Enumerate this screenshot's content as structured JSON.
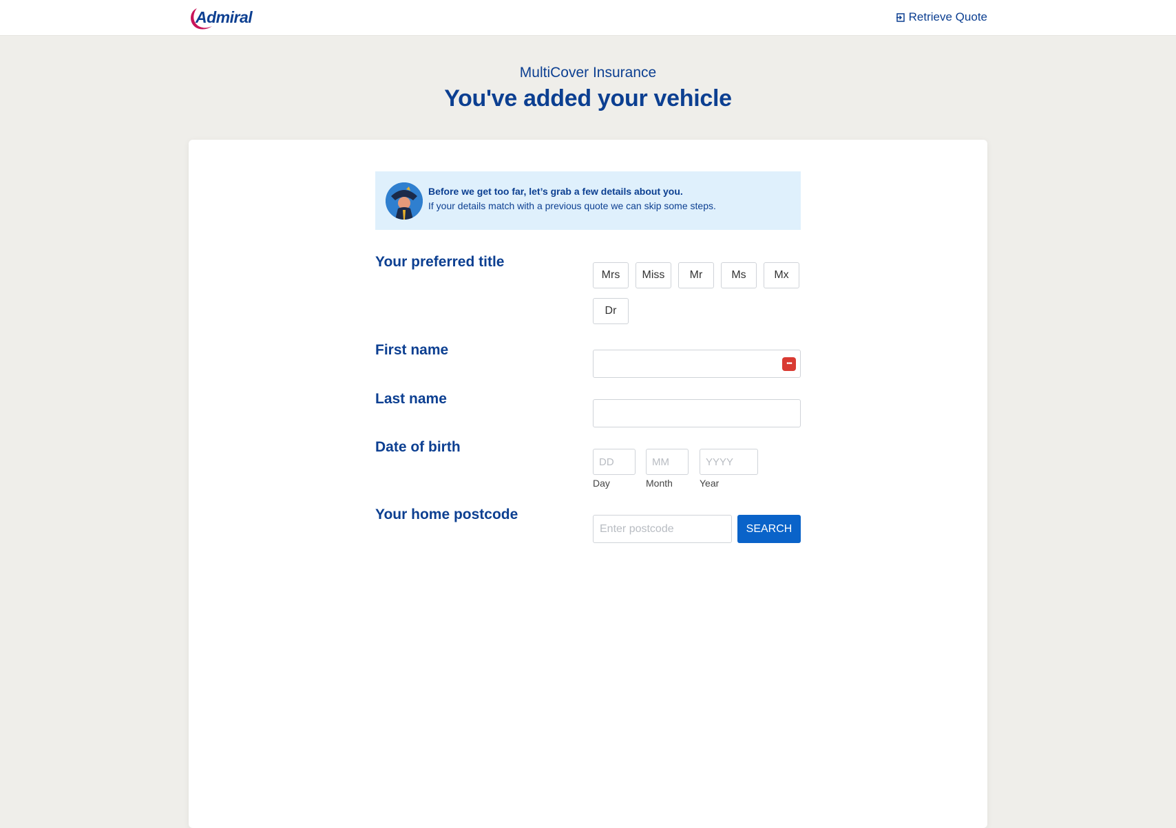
{
  "header": {
    "logo_text": "Admiral",
    "retrieve_label": "Retrieve Quote"
  },
  "hero": {
    "subtitle": "MultiCover Insurance",
    "title": "You've added your vehicle"
  },
  "info": {
    "bold_line": "Before we get too far, let’s grab a few details about you.",
    "line": "If your details match with a previous quote we can skip some steps."
  },
  "form": {
    "title_label": "Your preferred title",
    "titles": [
      "Mrs",
      "Miss",
      "Mr",
      "Ms",
      "Mx",
      "Dr"
    ],
    "first_name_label": "First name",
    "first_name_value": "",
    "last_name_label": "Last name",
    "last_name_value": "",
    "dob_label": "Date of birth",
    "dob": {
      "day_placeholder": "DD",
      "month_placeholder": "MM",
      "year_placeholder": "YYYY",
      "day_label": "Day",
      "month_label": "Month",
      "year_label": "Year"
    },
    "postcode_label": "Your home postcode",
    "postcode_placeholder": "Enter postcode",
    "search_label": "SEARCH"
  },
  "colors": {
    "brand_blue": "#0c3f91",
    "button_blue": "#0a63c9",
    "info_bg": "#dff0fc",
    "page_bg": "#efeeea",
    "logo_accent": "#c8145a"
  },
  "icons": {
    "retrieve": "login-arrow-icon",
    "password_manager": "password-manager-icon"
  }
}
